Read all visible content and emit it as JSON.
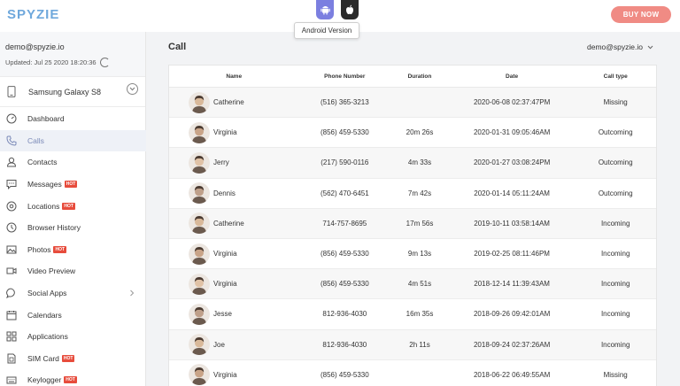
{
  "header": {
    "logo": "SPYZIE",
    "tooltip": "Android Version",
    "buy_label": "BUY NOW"
  },
  "account": {
    "email": "demo@spyzie.io",
    "updated": "Updated: Jul 25 2020 18:20:36",
    "device": "Samsung Galaxy S8"
  },
  "sidebar": {
    "items": [
      {
        "label": "Dashboard",
        "icon": "dashboard-icon",
        "hot": false
      },
      {
        "label": "Calls",
        "icon": "phone-icon",
        "hot": false
      },
      {
        "label": "Contacts",
        "icon": "contacts-icon",
        "hot": false
      },
      {
        "label": "Messages",
        "icon": "messages-icon",
        "hot": true
      },
      {
        "label": "Locations",
        "icon": "location-icon",
        "hot": true
      },
      {
        "label": "Browser History",
        "icon": "history-icon",
        "hot": false
      },
      {
        "label": "Photos",
        "icon": "photos-icon",
        "hot": true
      },
      {
        "label": "Video Preview",
        "icon": "video-icon",
        "hot": false
      },
      {
        "label": "Social Apps",
        "icon": "chat-icon",
        "hot": false
      },
      {
        "label": "Calendars",
        "icon": "calendar-icon",
        "hot": false
      },
      {
        "label": "Applications",
        "icon": "apps-icon",
        "hot": false
      },
      {
        "label": "SIM Card",
        "icon": "sim-icon",
        "hot": true
      },
      {
        "label": "Keylogger",
        "icon": "keyboard-icon",
        "hot": true
      }
    ],
    "hot_label": "HOT"
  },
  "main": {
    "title": "Call",
    "user": "demo@spyzie.io"
  },
  "table": {
    "headers": [
      "Name",
      "Phone Number",
      "Duration",
      "Date",
      "Call type"
    ],
    "rows": [
      {
        "name": "Catherine",
        "phone": "(516) 365-3213",
        "duration": "",
        "date": "2020-06-08 02:37:47PM",
        "type": "Missing"
      },
      {
        "name": "Virginia",
        "phone": "(856) 459-5330",
        "duration": "20m 26s",
        "date": "2020-01-31 09:05:46AM",
        "type": "Outcoming"
      },
      {
        "name": "Jerry",
        "phone": "(217) 590-0116",
        "duration": "4m 33s",
        "date": "2020-01-27 03:08:24PM",
        "type": "Outcoming"
      },
      {
        "name": "Dennis",
        "phone": "(562) 470-6451",
        "duration": "7m 42s",
        "date": "2020-01-14 05:11:24AM",
        "type": "Outcoming"
      },
      {
        "name": "Catherine",
        "phone": "714-757-8695",
        "duration": "17m 56s",
        "date": "2019-10-11 03:58:14AM",
        "type": "Incoming"
      },
      {
        "name": "Virginia",
        "phone": "(856) 459-5330",
        "duration": "9m 13s",
        "date": "2019-02-25 08:11:46PM",
        "type": "Incoming"
      },
      {
        "name": "Virginia",
        "phone": "(856) 459-5330",
        "duration": "4m 51s",
        "date": "2018-12-14 11:39:43AM",
        "type": "Incoming"
      },
      {
        "name": "Jesse",
        "phone": "812-936-4030",
        "duration": "16m 35s",
        "date": "2018-09-26 09:42:01AM",
        "type": "Incoming"
      },
      {
        "name": "Joe",
        "phone": "812-936-4030",
        "duration": "2h 11s",
        "date": "2018-09-24 02:37:26AM",
        "type": "Incoming"
      },
      {
        "name": "Virginia",
        "phone": "(856) 459-5330",
        "duration": "",
        "date": "2018-06-22 06:49:55AM",
        "type": "Missing"
      }
    ]
  },
  "colors": {
    "brand": "#6fa8dc",
    "buy": "#f08b84",
    "android": "#7b7fe0",
    "hot": "#e74c3c"
  }
}
